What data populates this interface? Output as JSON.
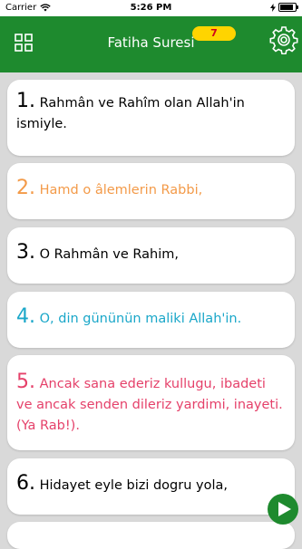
{
  "status": {
    "carrier": "Carrier",
    "time": "5:26 PM"
  },
  "header": {
    "title": "Fatiha Suresi",
    "badge": "7"
  },
  "verses": [
    {
      "num": "1.",
      "text": "Rahmân ve Rahîm olan Allah'in ismiyle.",
      "color": "#000000"
    },
    {
      "num": "2.",
      "text": "Hamd o âlemlerin Rabbi,",
      "color": "#f39a48"
    },
    {
      "num": "3.",
      "text": "O Rahmân ve Rahim,",
      "color": "#000000"
    },
    {
      "num": "4.",
      "text": "O, din gününün maliki Allah'in.",
      "color": "#1aa7c9"
    },
    {
      "num": "5.",
      "text": "Ancak sana ederiz kullugu, ibadeti ve ancak senden dileriz yardimi, inayeti. (Ya Rab!).",
      "color": "#e5416a"
    },
    {
      "num": "6.",
      "text": "Hidayet eyle bizi dogru yola,",
      "color": "#000000"
    }
  ],
  "colors": {
    "header": "#1e8a2e",
    "badge": "#ffd400",
    "background": "#d9d9d9"
  }
}
